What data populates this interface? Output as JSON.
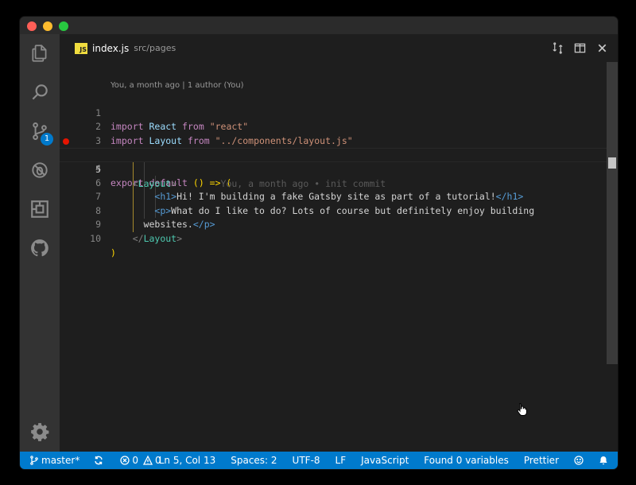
{
  "tab": {
    "badge": "JS",
    "filename": "index.js",
    "path": "src/pages"
  },
  "codelens": "You, a month ago | 1 author (You)",
  "activity": {
    "scm_badge": "1"
  },
  "lines": [
    {
      "n": "1"
    },
    {
      "n": "2"
    },
    {
      "n": "3"
    },
    {
      "n": "4"
    },
    {
      "n": "5"
    },
    {
      "n": "6"
    },
    {
      "n": "7"
    },
    {
      "n": "8"
    },
    {
      "n": "9"
    },
    {
      "n": "10"
    }
  ],
  "code": {
    "l1": {
      "import": "import",
      "name": "React",
      "from": "from",
      "str": "\"react\""
    },
    "l2": {
      "import": "import",
      "name": "Layout",
      "from": "from",
      "str": "\"../components/layout.js\""
    },
    "l4": {
      "export": "export",
      "default": "default",
      "rest": "() => ("
    },
    "l5": {
      "open": "<",
      "tag": "Layout",
      "close": ">",
      "blame": "You, a month ago • init commit"
    },
    "l6": {
      "open": "<h1>",
      "text": "Hi! I'm building a fake Gatsby site as part of a tutorial!",
      "close": "</h1>"
    },
    "l7": {
      "open": "<p>",
      "text": "What do I like to do? Lots of course but definitely enjoy building"
    },
    "l8": {
      "text": "websites.",
      "close": "</p>"
    },
    "l9": {
      "open": "</",
      "tag": "Layout",
      "close": ">"
    },
    "l10": {
      "paren": ")"
    }
  },
  "status": {
    "branch": "master*",
    "errors": "0",
    "warnings": "0",
    "position": "Ln 5, Col 13",
    "spaces": "Spaces: 2",
    "encoding": "UTF-8",
    "eol": "LF",
    "language": "JavaScript",
    "variables": "Found 0 variables",
    "formatter": "Prettier"
  },
  "colors": {
    "statusbar": "#007acc",
    "breakpoint": "#e51400",
    "js_badge": "#f1dd3f"
  }
}
